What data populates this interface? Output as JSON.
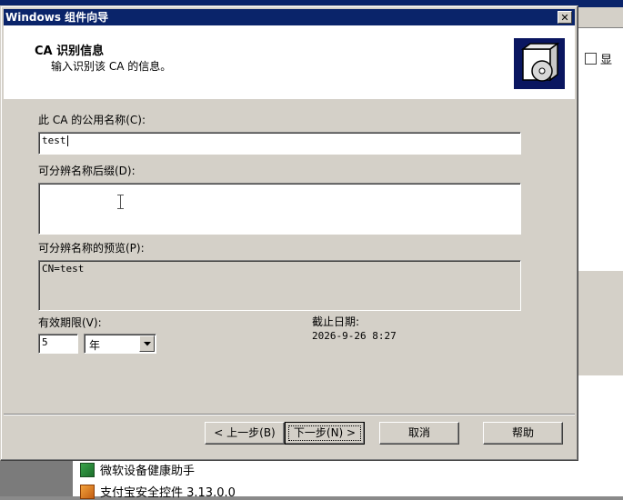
{
  "background": {
    "right_label": "显",
    "list_items": [
      {
        "icon": "green-shield-icon",
        "label": "微软设备健康助手"
      },
      {
        "icon": "orange-package-icon",
        "label": "支付宝安全控件 3.13.0.0"
      }
    ]
  },
  "dialog": {
    "title": "Windows 组件向导",
    "close_glyph": "✕",
    "header": {
      "title": "CA 识别信息",
      "subtitle": "输入识别该 CA 的信息。",
      "icon": "software-box-cd-icon"
    },
    "common_name": {
      "label": "此 CA 的公用名称(C):",
      "value": "test"
    },
    "dn_suffix": {
      "label": "可分辨名称后缀(D):",
      "value": ""
    },
    "dn_preview": {
      "label": "可分辨名称的预览(P):",
      "value": "CN=test"
    },
    "validity": {
      "label": "有效期限(V):",
      "value": "5",
      "unit": "年",
      "expiry_label": "截止日期:",
      "expiry_value": "2026-9-26 8:27"
    },
    "buttons": {
      "back": "< 上一步(B)",
      "next": "下一步(N) >",
      "cancel": "取消",
      "help": "帮助"
    }
  },
  "colors": {
    "titlebar": "#0a246a",
    "dialog_face": "#d4d0c8",
    "header_bg": "#ffffff",
    "icon_bg": "#0a1660"
  }
}
